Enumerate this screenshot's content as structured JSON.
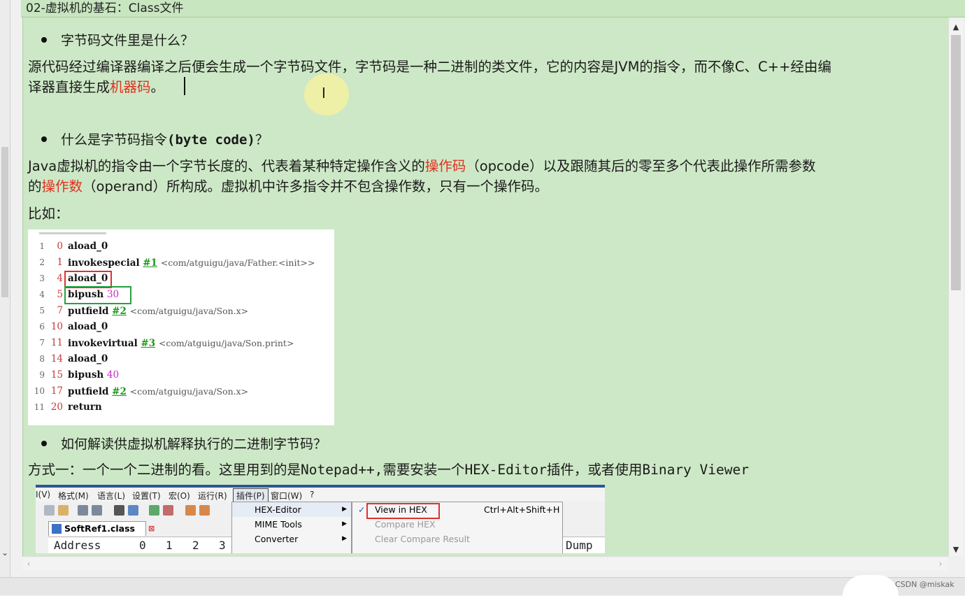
{
  "header": {
    "title": "02-虚拟机的基石：Class文件"
  },
  "sections": {
    "q1": "字节码文件里是什么？",
    "p1": {
      "line1": "源代码经过编译器编译之后便会生成一个字节码文件，字节码是一种二进制的类文件，它的内容是JVM的指令，而不像C、C++经由编",
      "line2_prefix": "译器直接生成",
      "line2_red": "机器码",
      "line2_suffix": "。"
    },
    "q2_prefix": "什么是字节码指令",
    "q2_code": "(byte code)",
    "q2_suffix": "？",
    "p2": {
      "l1_a": " Java虚拟机的指令由一个字节长度的、代表着某种特定操作含义的",
      "l1_red": "操作码",
      "l1_b": "（opcode）以及跟随其后的零至多个代表此操作所需参数",
      "l2_a": "的",
      "l2_red": "操作数",
      "l2_b": "（operand）所构成。虚拟机中许多指令并不包含操作数，只有一个操作码。"
    },
    "example_label": "比如：",
    "q3": "如何解读供虚拟机解释执行的二进制字节码？",
    "p3_a": "方式一：一个一个二进制的看。这里用到的是",
    "p3_b": "Notepad++,",
    "p3_c": "需要安装一个",
    "p3_d": "HEX-Editor",
    "p3_e": "插件，或者使用",
    "p3_f": "Binary Viewer"
  },
  "bytecode": [
    {
      "ln": "1",
      "off": "0",
      "ins": "aload_0"
    },
    {
      "ln": "2",
      "off": "1",
      "ins": "invokespecial",
      "ref": "#1",
      "cmt": "<com/atguigu/java/Father.<init>>"
    },
    {
      "ln": "3",
      "off": "4",
      "ins": "aload_0"
    },
    {
      "ln": "4",
      "off": "5",
      "ins": "bipush",
      "num": "30"
    },
    {
      "ln": "5",
      "off": "7",
      "ins": "putfield",
      "ref": "#2",
      "cmt": "<com/atguigu/java/Son.x>"
    },
    {
      "ln": "6",
      "off": "10",
      "ins": "aload_0"
    },
    {
      "ln": "7",
      "off": "11",
      "ins": "invokevirtual",
      "ref": "#3",
      "cmt": "<com/atguigu/java/Son.print>"
    },
    {
      "ln": "8",
      "off": "14",
      "ins": "aload_0"
    },
    {
      "ln": "9",
      "off": "15",
      "ins": "bipush",
      "num": "40"
    },
    {
      "ln": "10",
      "off": "17",
      "ins": "putfield",
      "ref": "#2",
      "cmt": "<com/atguigu/java/Son.x>"
    },
    {
      "ln": "11",
      "off": "20",
      "ins": "return"
    }
  ],
  "npp": {
    "menus": [
      "I(V)",
      "格式(M)",
      "语言(L)",
      "设置(T)",
      "宏(O)",
      "运行(R)",
      "插件(P)",
      "窗口(W)",
      "?"
    ],
    "tab": "SoftRef1.class",
    "hex_header": {
      "address": "Address",
      "c0": "0",
      "c1": "1",
      "c2": "2",
      "c3": "3",
      "dump": "Dump"
    },
    "plugins_menu": [
      "HEX-Editor",
      "MIME Tools",
      "Converter"
    ],
    "hex_submenu": {
      "view": "View in HEX",
      "shortcut": "Ctrl+Alt+Shift+H",
      "compare": "Compare HEX",
      "clear": "Clear Compare Result",
      "check": "✓"
    }
  },
  "watermark": "CSDN @miskak",
  "icons": {
    "ibeam": "I",
    "up": "▲",
    "down": "▼",
    "left": "‹",
    "right": "›",
    "strip_arrow": "⌄",
    "tab_close": "⊠",
    "submenu_arrow": "▶"
  },
  "colors": {
    "note_bg": "#cde8c6",
    "header_bg": "#c8e6c0",
    "highlight_red": "#e0301e"
  }
}
